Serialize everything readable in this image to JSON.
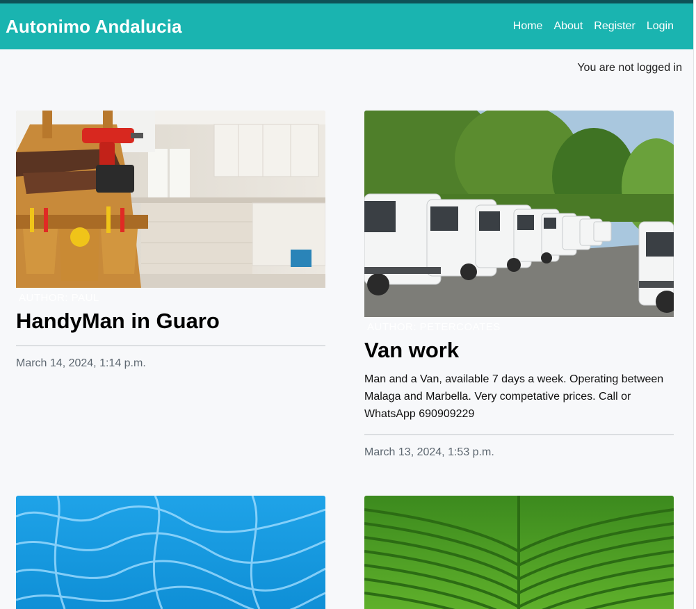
{
  "header": {
    "brand": "Autonimo Andalucia",
    "nav": [
      "Home",
      "About",
      "Register",
      "Login"
    ]
  },
  "status_text": "You are not logged in",
  "posts": [
    {
      "image": "handyman-with-drill-and-tool-belt",
      "author": "AUTHOR: PAUL",
      "title": "HandyMan in Guaro",
      "excerpt": "",
      "date": "March 14, 2024, 1:14 p.m."
    },
    {
      "image": "row-of-white-vans",
      "author": "AUTHOR: PETERCOATES",
      "title": "Van work",
      "excerpt": "Man and a Van, available 7 days a week. Operating between Malaga and Marbella. Very competative prices. Call or WhatsApp 690909229",
      "date": "March 13, 2024, 1:53 p.m."
    },
    {
      "image": "pool-water"
    },
    {
      "image": "green-field-rows"
    }
  ],
  "colors": {
    "navbar": "#1ab4b0",
    "top_strip": "#0e5257",
    "background": "#f7f8fa"
  }
}
